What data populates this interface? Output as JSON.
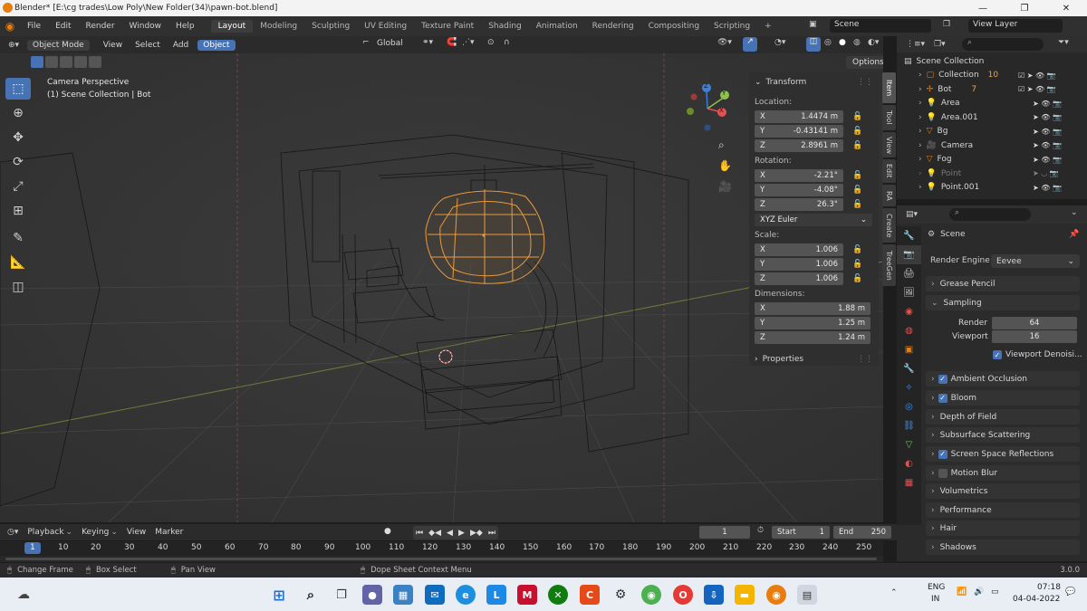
{
  "window": {
    "title": "Blender* [E:\\cg trades\\Low Poly\\New Folder(34)\\pawn-bot.blend]",
    "minimize": "—",
    "maximize": "❐",
    "close": "✕"
  },
  "menu": {
    "items": [
      "File",
      "Edit",
      "Render",
      "Window",
      "Help"
    ],
    "workspaces": [
      "Layout",
      "Modeling",
      "Sculpting",
      "UV Editing",
      "Texture Paint",
      "Shading",
      "Animation",
      "Rendering",
      "Compositing",
      "Scripting"
    ],
    "active_workspace": "Layout",
    "add_workspace": "+",
    "scene": "Scene",
    "view_layer": "View Layer"
  },
  "viewport_header": {
    "mode": "Object Mode",
    "menus": [
      "View",
      "Select",
      "Add"
    ],
    "active_menu": "Object",
    "transform_orientation": "Global",
    "options": "Options"
  },
  "viewport": {
    "camera_label": "Camera Perspective",
    "collection_label": "(1) Scene Collection | Bot",
    "gizmo_axes": [
      "Z",
      "Y",
      "X"
    ]
  },
  "npanel": {
    "transform_header": "Transform",
    "location_label": "Location:",
    "location": [
      {
        "axis": "X",
        "value": "1.4474 m"
      },
      {
        "axis": "Y",
        "value": "-0.43141 m"
      },
      {
        "axis": "Z",
        "value": "2.8961 m"
      }
    ],
    "rotation_label": "Rotation:",
    "rotation": [
      {
        "axis": "X",
        "value": "-2.21°"
      },
      {
        "axis": "Y",
        "value": "-4.08°"
      },
      {
        "axis": "Z",
        "value": "26.3°"
      }
    ],
    "rotation_mode": "XYZ Euler",
    "scale_label": "Scale:",
    "scale": [
      {
        "axis": "X",
        "value": "1.006"
      },
      {
        "axis": "Y",
        "value": "1.006"
      },
      {
        "axis": "Z",
        "value": "1.006"
      }
    ],
    "dimensions_label": "Dimensions:",
    "dimensions": [
      {
        "axis": "X",
        "value": "1.88 m"
      },
      {
        "axis": "Y",
        "value": "1.25 m"
      },
      {
        "axis": "Z",
        "value": "1.24 m"
      }
    ],
    "properties_header": "Properties",
    "tabs": [
      "Item",
      "Tool",
      "View",
      "Edit",
      "RA",
      "Create",
      "TreeGen"
    ]
  },
  "outliner": {
    "root": "Scene Collection",
    "items": [
      {
        "name": "Collection",
        "badge": "10"
      },
      {
        "name": "Bot",
        "badge": "7"
      },
      {
        "name": "Area",
        "badge": ""
      },
      {
        "name": "Area.001",
        "badge": ""
      },
      {
        "name": "Bg",
        "badge": ""
      },
      {
        "name": "Camera",
        "badge": ""
      },
      {
        "name": "Fog",
        "badge": ""
      },
      {
        "name": "Point",
        "badge": ""
      },
      {
        "name": "Point.001",
        "badge": ""
      }
    ]
  },
  "properties": {
    "scene_label": "Scene",
    "render_engine_label": "Render Engine",
    "render_engine": "Eevee",
    "grease_pencil": "Grease Pencil",
    "sampling": "Sampling",
    "render_label": "Render",
    "render_value": "64",
    "viewport_label": "Viewport",
    "viewport_value": "16",
    "viewport_denoise": "Viewport Denoisi...",
    "sections": [
      {
        "label": "Ambient Occlusion",
        "check": true
      },
      {
        "label": "Bloom",
        "check": true
      },
      {
        "label": "Depth of Field",
        "check": null
      },
      {
        "label": "Subsurface Scattering",
        "check": null
      },
      {
        "label": "Screen Space Reflections",
        "check": true
      },
      {
        "label": "Motion Blur",
        "check": false
      },
      {
        "label": "Volumetrics",
        "check": null
      },
      {
        "label": "Performance",
        "check": null
      },
      {
        "label": "Hair",
        "check": null
      },
      {
        "label": "Shadows",
        "check": null
      }
    ]
  },
  "timeline": {
    "menus": [
      "Playback",
      "Keying",
      "View",
      "Marker"
    ],
    "current_frame": "1",
    "start_label": "Start",
    "start": "1",
    "end_label": "End",
    "end": "250",
    "ruler": [
      "1",
      "10",
      "20",
      "30",
      "40",
      "50",
      "60",
      "70",
      "80",
      "90",
      "100",
      "110",
      "120",
      "130",
      "140",
      "150",
      "160",
      "170",
      "180",
      "190",
      "200",
      "210",
      "220",
      "230",
      "240",
      "250"
    ]
  },
  "statusbar": {
    "change_frame": "Change Frame",
    "box_select": "Box Select",
    "pan_view": "Pan View",
    "context_menu": "Dope Sheet Context Menu",
    "version": "3.0.0"
  },
  "taskbar": {
    "lang": "ENG",
    "region": "IN",
    "time": "07:18",
    "date": "04-04-2022"
  }
}
